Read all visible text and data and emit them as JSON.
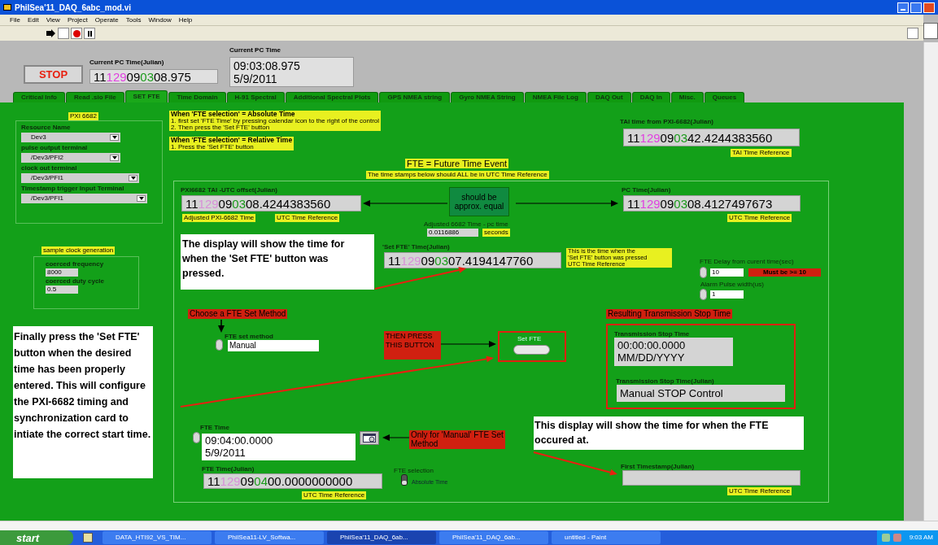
{
  "window": {
    "title": "PhilSea'11_DAQ_6abc_mod.vi"
  },
  "menu": [
    "File",
    "Edit",
    "View",
    "Project",
    "Operate",
    "Tools",
    "Window",
    "Help"
  ],
  "header": {
    "stop_button": "STOP",
    "julian_label": "Current PC Time(Julian)",
    "julian_value": [
      {
        "text": "11",
        "color": "#000000"
      },
      {
        "text": "129",
        "color": "#e040e0"
      },
      {
        "text": "09",
        "color": "#000000"
      },
      {
        "text": "03",
        "color": "#1a9a1a"
      },
      {
        "text": "08.975",
        "color": "#000000"
      }
    ],
    "pc_time_label": "Current PC Time",
    "pc_time_value": [
      "09:03:08.975",
      "5/9/2011"
    ]
  },
  "tabs": [
    {
      "label": "Critical Info",
      "selected": false
    },
    {
      "label": "Read .sio File",
      "selected": false
    },
    {
      "label": "SET FTE",
      "selected": true
    },
    {
      "label": "Time Domain",
      "selected": false
    },
    {
      "label": "H-91 Spectral",
      "selected": false
    },
    {
      "label": "Additional Spectral Plots",
      "selected": false
    },
    {
      "label": "GPS NMEA string",
      "selected": false
    },
    {
      "label": "Gyro NMEA String",
      "selected": false
    },
    {
      "label": "NMEA File Log",
      "selected": false
    },
    {
      "label": "DAQ Out",
      "selected": false
    },
    {
      "label": "DAQ In",
      "selected": false
    },
    {
      "label": "Misc.",
      "selected": false
    },
    {
      "label": "Queues",
      "selected": false
    }
  ],
  "panel": {
    "pxi_label": "PXI 6682",
    "resource_group": [
      {
        "label": "Resource Name",
        "value": "Dev3"
      },
      {
        "label": "pulse output terminal",
        "value": "/Dev3/PFI2"
      },
      {
        "label": "clock out terminal",
        "value": "/Dev3/PFI1"
      },
      {
        "label": "Timestamp trigger Input Terminal",
        "value": "/Dev3/PFI1"
      }
    ],
    "sample_clock": {
      "title": "sample clock generation",
      "fields": [
        {
          "label": "coerced frequency",
          "value": "8000"
        },
        {
          "label": "coerced duty cycle",
          "value": "0.5"
        }
      ]
    },
    "instructions": [
      {
        "heading": "When 'FTE selection' = Absolute Time",
        "lines": [
          "1. first set 'FTE Time' by pressing calendar icon to the right of the control",
          "2. Then press the 'Set FTE' button"
        ]
      },
      {
        "heading": "When 'FTE selection' = Relative Time",
        "lines": [
          "1. Press the 'Set FTE' button"
        ]
      }
    ],
    "tai": {
      "label": "TAI time from PXI-6682(Julian)",
      "value": [
        {
          "text": "11",
          "color": "#000000"
        },
        {
          "text": "129",
          "color": "#e040e0"
        },
        {
          "text": "09",
          "color": "#000000"
        },
        {
          "text": "03",
          "color": "#1a9a1a"
        },
        {
          "text": "42.4244383560",
          "color": "#000000"
        }
      ],
      "tag": "TAI Time Reference"
    },
    "fte_title": "FTE = Future Time Event",
    "fte_subtitle": "The time stamps below should ALL be in UTC Time Reference",
    "offset": {
      "label": "PXI6682 TAI -UTC offset(Julian)",
      "value": [
        {
          "text": "11",
          "color": "#000000"
        },
        {
          "text": "129",
          "color": "#d890d8"
        },
        {
          "text": "09",
          "color": "#000000"
        },
        {
          "text": "03",
          "color": "#1a9a1a"
        },
        {
          "text": "08.4244383560",
          "color": "#000000"
        }
      ],
      "tags": [
        "Adjusted PXI-6682 Time",
        "UTC Time Reference"
      ]
    },
    "equal_note": "should be approx. equal",
    "pc_time": {
      "label": "PC Time(Julian)",
      "value": [
        {
          "text": "11",
          "color": "#000000"
        },
        {
          "text": "129",
          "color": "#e040e0"
        },
        {
          "text": "09",
          "color": "#000000"
        },
        {
          "text": "03",
          "color": "#1a9a1a"
        },
        {
          "text": "08.4127497673",
          "color": "#000000"
        }
      ],
      "tag": "UTC Time Reference"
    },
    "difference": {
      "label": "Adjusted 6682 Time - pc time",
      "value": "0.0116886",
      "unit": "seconds"
    },
    "note_set_fte": "The display will show the time for when the 'Set FTE' button was pressed.",
    "set_fte_time": {
      "label": "'Set FTE' Time(Julian)",
      "value": [
        {
          "text": "11",
          "color": "#000000"
        },
        {
          "text": "129",
          "color": "#d890d8"
        },
        {
          "text": "09",
          "color": "#000000"
        },
        {
          "text": "03",
          "color": "#1a9a1a"
        },
        {
          "text": "07.4194147760",
          "color": "#000000"
        }
      ],
      "note": [
        "This is the time when the",
        "'Set FTE' button was pressed",
        "UTC Time Reference"
      ]
    },
    "delay": {
      "label": "FTE Delay from curent time(sec)",
      "value": "10",
      "warning": "Must be >= 10"
    },
    "pulse": {
      "label": "Alarm Pulse width(us)",
      "value": "1"
    },
    "method_heading": "Choose a FTE Set Method",
    "method": {
      "label": "FTE set method",
      "value": "Manual"
    },
    "then_press": "THEN PRESS THIS BUTTON",
    "set_fte_button": {
      "label": "Set FTE"
    },
    "stop_heading": "Resulting Transmission Stop Time",
    "stop_time": {
      "label": "Transmission Stop Time",
      "value": [
        "00:00:00.0000",
        "MM/DD/YYYY"
      ]
    },
    "stop_julian": {
      "label": "Transmission Stop Time(Julian)",
      "value": "Manual STOP Control"
    },
    "note_finally": "Finally press the 'Set FTE' button when the desired time has been properly entered. This will configure the PXI-6682 timing and synchronization card to intiate the correct start time.",
    "fte_time": {
      "label": "FTE Time",
      "value": [
        "09:04:00.0000",
        "5/9/2011"
      ]
    },
    "manual_note": "Only for 'Manual' FTE Set Method",
    "fte_julian": {
      "label": "FTE Time(Julian)",
      "value": [
        {
          "text": "11",
          "color": "#000000"
        },
        {
          "text": "129",
          "color": "#d890d8"
        },
        {
          "text": "09",
          "color": "#000000"
        },
        {
          "text": "04",
          "color": "#1a9a1a"
        },
        {
          "text": "00.0000000000",
          "color": "#000000"
        }
      ],
      "tag": "UTC Time Reference"
    },
    "fte_selection": {
      "label": "FTE selection",
      "value": "Absolute Time",
      "on": false
    },
    "note_fte_occured": "This display will show the time for when the FTE occured at.",
    "first_timestamp": {
      "label": "First Timestamp(Julian)",
      "tag": "UTC Time Reference"
    }
  },
  "taskbar": {
    "start": "start",
    "items": [
      {
        "label": "DATA_HTI92_VS_TIM...",
        "selected": false
      },
      {
        "label": "PhilSea11-LV_Softwa...",
        "selected": false
      },
      {
        "label": "PhilSea'11_DAQ_6ab...",
        "selected": true
      },
      {
        "label": "PhilSea'11_DAQ_6ab...",
        "selected": false
      },
      {
        "label": "untitled - Paint",
        "selected": false
      }
    ],
    "clock": "9:03 AM"
  }
}
